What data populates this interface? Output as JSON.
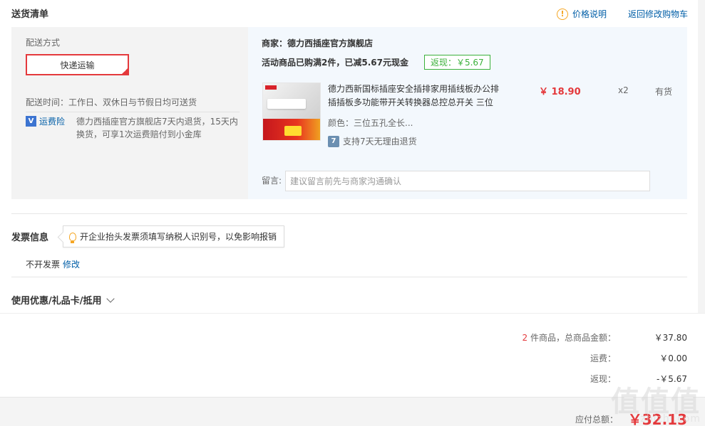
{
  "header": {
    "title": "送货清单",
    "price_help": "价格说明",
    "price_help_icon": "!",
    "back_to_cart": "返回修改购物车"
  },
  "delivery": {
    "method_label": "配送方式",
    "method_value": "快递运输",
    "time_text": "配送时间：工作日、双休日与节假日均可送货",
    "insurance_link": "运费险",
    "insurance_icon": "V",
    "insurance_desc": "德力西插座官方旗舰店7天内退货，15天内换货，可享1次运费赔付到小金库"
  },
  "shop": {
    "name": "商家：德力西插座官方旗舰店",
    "promo_text": "活动商品已购满2件，已减5.67元现金",
    "cashback_tag": "返现：￥5.67"
  },
  "product": {
    "title": "德力西新国标插座安全插排家用插线板办公排插插板多功能带开关转换器总控总开关 三位",
    "price": "￥ 18.90",
    "qty": "x2",
    "stock": "有货",
    "color": "颜色：三位五孔全长...",
    "return_policy": "支持7天无理由退货",
    "return_icon": "7"
  },
  "note": {
    "label": "留言:",
    "placeholder": "建议留言前先与商家沟通确认"
  },
  "invoice": {
    "title": "发票信息",
    "tip": "开企业抬头发票须填写纳税人识别号，以免影响报销",
    "status": "不开发票",
    "edit": "修改"
  },
  "coupon": {
    "label": "使用优惠/礼品卡/抵用"
  },
  "summary": {
    "count": "2",
    "items_label": " 件商品，总商品金额：",
    "items_value": "￥37.80",
    "shipping_label": "运费：",
    "shipping_value": "￥0.00",
    "cashback_label": "返现：",
    "cashback_value": "-￥5.67",
    "total_label": "应付总额：",
    "total_value": "￥32.13"
  },
  "watermark": {
    "logo": "值值值",
    "url": "zhizhi.com"
  },
  "colors": {
    "accent_red": "#e4393c",
    "link_blue": "#005ea7",
    "cashback_green": "#3bb13b",
    "warning_orange": "#f5a623"
  }
}
